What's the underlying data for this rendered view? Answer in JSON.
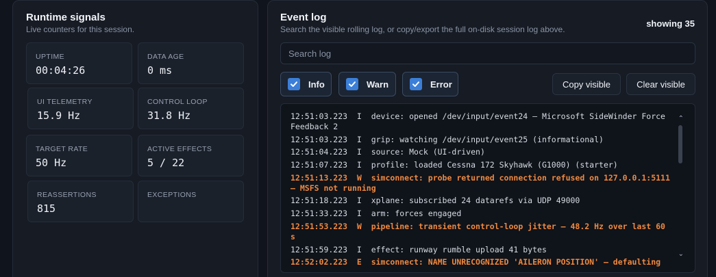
{
  "runtime": {
    "title": "Runtime signals",
    "subtitle": "Live counters for this session.",
    "cards": [
      {
        "label": "UPTIME",
        "value": "00:04:26"
      },
      {
        "label": "DATA AGE",
        "value": "0 ms"
      },
      {
        "label": "UI TELEMETRY",
        "value": "15.9 Hz"
      },
      {
        "label": "CONTROL LOOP",
        "value": "31.8 Hz"
      },
      {
        "label": "TARGET RATE",
        "value": "50 Hz"
      },
      {
        "label": "ACTIVE EFFECTS",
        "value": "5 / 22"
      },
      {
        "label": "REASSERTIONS",
        "value": "815"
      },
      {
        "label": "EXCEPTIONS",
        "value": ""
      }
    ]
  },
  "eventlog": {
    "title": "Event log",
    "subtitle": "Search the visible rolling log, or copy/export the full on-disk session log above.",
    "showing": "showing 35",
    "search_placeholder": "Search log",
    "filters": [
      {
        "label": "Info",
        "checked": true
      },
      {
        "label": "Warn",
        "checked": true
      },
      {
        "label": "Error",
        "checked": true
      }
    ],
    "copy_label": "Copy visible",
    "clear_label": "Clear visible",
    "scroll_up": "⌃",
    "scroll_down": "⌄",
    "lines": [
      {
        "level": "info",
        "text": "12:51:03.223  I  device: opened /dev/input/event24 — Microsoft SideWinder Force Feedback 2"
      },
      {
        "level": "info",
        "text": "12:51:03.223  I  grip: watching /dev/input/event25 (informational)"
      },
      {
        "level": "info",
        "text": "12:51:04.223  I  source: Mock (UI-driven)"
      },
      {
        "level": "info",
        "text": "12:51:07.223  I  profile: loaded Cessna 172 Skyhawk (G1000) (starter)"
      },
      {
        "level": "warn",
        "text": "12:51:13.223  W  simconnect: probe returned connection refused on 127.0.0.1:5111 — MSFS not running"
      },
      {
        "level": "info",
        "text": "12:51:18.223  I  xplane: subscribed 24 datarefs via UDP 49000"
      },
      {
        "level": "info",
        "text": "12:51:33.223  I  arm: forces engaged"
      },
      {
        "level": "warn",
        "text": "12:51:53.223  W  pipeline: transient control-loop jitter — 48.2 Hz over last 60 s"
      },
      {
        "level": "info",
        "text": "12:51:59.223  I  effect: runway rumble upload 41 bytes"
      },
      {
        "level": "error",
        "text": "12:52:02.223  E  simconnect: NAME UNRECOGNIZED 'AILERON POSITION' — defaulting"
      }
    ]
  }
}
